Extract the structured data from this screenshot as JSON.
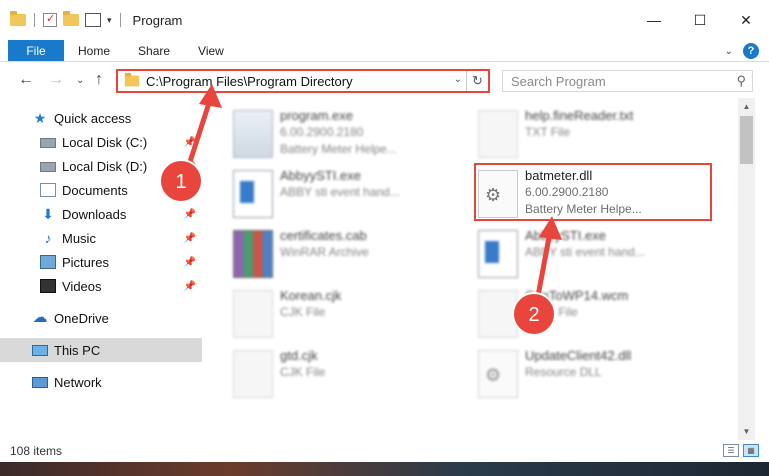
{
  "window": {
    "title": "Program",
    "controls": {
      "minimize": "—",
      "maximize": "☐",
      "close": "✕"
    }
  },
  "ribbon": {
    "tabs": [
      "File",
      "Home",
      "Share",
      "View"
    ],
    "help": "?"
  },
  "address": {
    "path": "C:\\Program Files\\Program Directory",
    "search_placeholder": "Search Program"
  },
  "sidebar": {
    "quick_access": "Quick access",
    "items": [
      {
        "label": "Local Disk (C:)",
        "icon": "drive-icon"
      },
      {
        "label": "Local Disk (D:)",
        "icon": "drive-icon"
      },
      {
        "label": "Documents",
        "icon": "documents-icon"
      },
      {
        "label": "Downloads",
        "icon": "download-icon"
      },
      {
        "label": "Music",
        "icon": "music-icon"
      },
      {
        "label": "Pictures",
        "icon": "pictures-icon"
      },
      {
        "label": "Videos",
        "icon": "videos-icon"
      }
    ],
    "onedrive": "OneDrive",
    "thispc": "This PC",
    "network": "Network"
  },
  "files": [
    {
      "name": "program.exe",
      "meta1": "6.00.2900.2180",
      "meta2": "Battery Meter Helpe..."
    },
    {
      "name": "help.fineReader.txt",
      "meta1": "TXT File",
      "meta2": ""
    },
    {
      "name": "AbbyySTI.exe",
      "meta1": "ABBY sti event hand...",
      "meta2": ""
    },
    {
      "name": "batmeter.dll",
      "meta1": "6.00.2900.2180",
      "meta2": "Battery Meter Helpe..."
    },
    {
      "name": "certificates.cab",
      "meta1": "WinRAR Archive",
      "meta2": ""
    },
    {
      "name": "AbbyySTI.exe",
      "meta1": "ABBY sti event hand...",
      "meta2": ""
    },
    {
      "name": "Korean.cjk",
      "meta1": "CJK File",
      "meta2": ""
    },
    {
      "name": "ConToWP14.wcm",
      "meta1": "WCM File",
      "meta2": ""
    },
    {
      "name": "gtd.cjk",
      "meta1": "CJK File",
      "meta2": ""
    },
    {
      "name": "UpdateClient42.dll",
      "meta1": "Resource DLL",
      "meta2": ""
    }
  ],
  "status": {
    "item_count": "108 items"
  },
  "annotations": {
    "step1": "1",
    "step2": "2",
    "accent": "#e8453c"
  }
}
